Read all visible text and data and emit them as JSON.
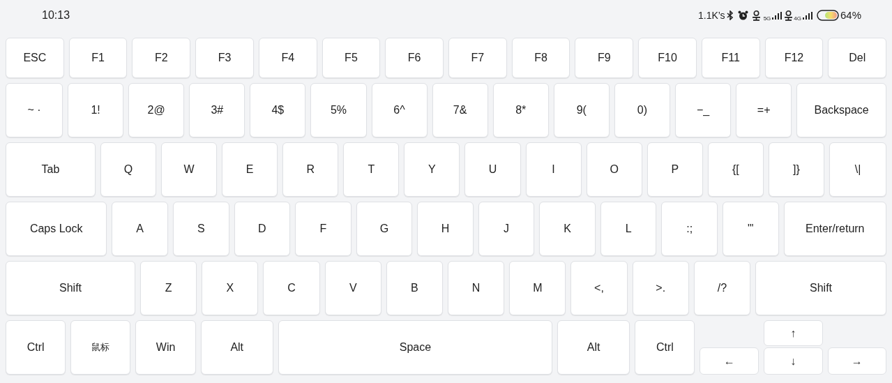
{
  "status_bar": {
    "time": "10:13",
    "network_speed": "1.1K’s",
    "sim_1_network": "5G",
    "sim_2_network": "4G",
    "battery": "64%"
  },
  "rows": [
    {
      "keys": [
        {
          "label": "ESC"
        },
        {
          "label": "F1"
        },
        {
          "label": "F2"
        },
        {
          "label": "F3"
        },
        {
          "label": "F4"
        },
        {
          "label": "F5"
        },
        {
          "label": "F6"
        },
        {
          "label": "F7"
        },
        {
          "label": "F8"
        },
        {
          "label": "F9"
        },
        {
          "label": "F10"
        },
        {
          "label": "F11"
        },
        {
          "label": "F12"
        },
        {
          "label": "Del"
        }
      ]
    },
    {
      "keys": [
        {
          "label": "~ ·"
        },
        {
          "label": "1!"
        },
        {
          "label": "2@"
        },
        {
          "label": "3#"
        },
        {
          "label": "4$"
        },
        {
          "label": "5%"
        },
        {
          "label": "6^"
        },
        {
          "label": "7&"
        },
        {
          "label": "8*"
        },
        {
          "label": "9("
        },
        {
          "label": "0)"
        },
        {
          "label": "−_"
        },
        {
          "label": "=+"
        },
        {
          "label": "Backspace"
        }
      ]
    },
    {
      "keys": [
        {
          "label": "Tab"
        },
        {
          "label": "Q"
        },
        {
          "label": "W"
        },
        {
          "label": "E"
        },
        {
          "label": "R"
        },
        {
          "label": "T"
        },
        {
          "label": "Y"
        },
        {
          "label": "U"
        },
        {
          "label": "I"
        },
        {
          "label": "O"
        },
        {
          "label": "P"
        },
        {
          "label": "{["
        },
        {
          "label": "]}"
        },
        {
          "label": "\\|"
        }
      ]
    },
    {
      "keys": [
        {
          "label": "Caps Lock"
        },
        {
          "label": "A"
        },
        {
          "label": "S"
        },
        {
          "label": "D"
        },
        {
          "label": "F"
        },
        {
          "label": "G"
        },
        {
          "label": "H"
        },
        {
          "label": "J"
        },
        {
          "label": "K"
        },
        {
          "label": "L"
        },
        {
          "label": ":;"
        },
        {
          "label": "\"'"
        },
        {
          "label": "Enter/return"
        }
      ]
    },
    {
      "keys": [
        {
          "label": "Shift"
        },
        {
          "label": "Z"
        },
        {
          "label": "X"
        },
        {
          "label": "C"
        },
        {
          "label": "V"
        },
        {
          "label": "B"
        },
        {
          "label": "N"
        },
        {
          "label": "M"
        },
        {
          "label": "<,"
        },
        {
          "label": ">."
        },
        {
          "label": "/?"
        },
        {
          "label": "Shift"
        }
      ]
    },
    {
      "keys": [
        {
          "label": "Ctrl"
        },
        {
          "label": "鼠标"
        },
        {
          "label": "Win"
        },
        {
          "label": "Alt"
        },
        {
          "label": "Space"
        },
        {
          "label": "Alt"
        },
        {
          "label": "Ctrl"
        }
      ]
    }
  ],
  "arrow_keys": [
    {
      "label": "↑"
    },
    {
      "label": "←"
    },
    {
      "label": "↓"
    },
    {
      "label": "→"
    }
  ]
}
